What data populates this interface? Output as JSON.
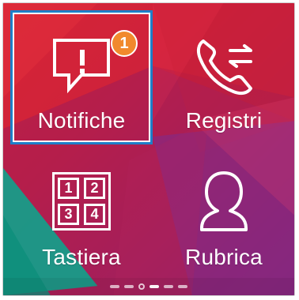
{
  "tiles": [
    {
      "label": "Notifiche",
      "badge": "1"
    },
    {
      "label": "Registri"
    },
    {
      "label": "Tastiera",
      "keys": [
        "1",
        "2",
        "3",
        "4"
      ]
    },
    {
      "label": "Rubrica"
    }
  ],
  "colors": {
    "badge": "#f1892d",
    "focus": "#1e7ec8",
    "text": "#ffffff"
  }
}
